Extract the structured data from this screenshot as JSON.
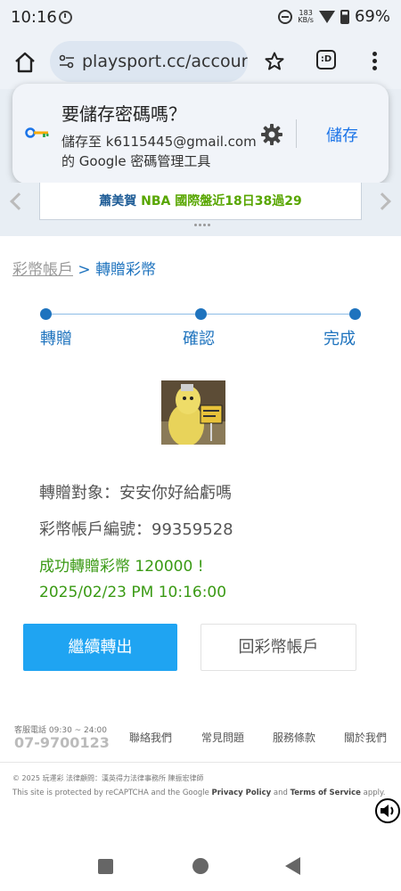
{
  "status_bar": {
    "time": "10:16",
    "net_speed_value": "183",
    "net_speed_unit": "KB/s",
    "battery": "69%"
  },
  "browser": {
    "url": "playsport.cc/accour",
    "tab_label": ":D"
  },
  "password_prompt": {
    "title": "要儲存密碼嗎？",
    "description_line1": "儲存至 k6115445@gmail.com",
    "description_line2": "的 Google 密碼管理工具",
    "save_label": "儲存"
  },
  "banner": {
    "name": "蕭美賀",
    "text": "NBA 國際盤近18日38過29"
  },
  "breadcrumb": {
    "parent": "彩幣帳戶",
    "separator": ">",
    "current": "轉贈彩幣"
  },
  "steps": [
    {
      "label": "轉贈"
    },
    {
      "label": "確認"
    },
    {
      "label": "完成"
    }
  ],
  "transfer": {
    "recipient": "轉贈對象：安安你好給虧嗎",
    "account_number": "彩幣帳戶編號：99359528",
    "success_message": "成功轉贈彩幣 120000 !",
    "timestamp": "2025/02/23 PM 10:16:00"
  },
  "actions": {
    "continue_label": "繼續轉出",
    "back_label": "回彩幣帳戶"
  },
  "footer": {
    "hotline_label": "客服電話 09:30 ~ 24:00",
    "hotline_number": "07-9700123",
    "links": [
      "聯絡我們",
      "常見問題",
      "服務條款",
      "關於我們"
    ],
    "copyright": "© 2025 玩運彩 法律顧問：漢英得力法律事務所 陳振宏律師",
    "recaptcha_prefix": "This site is protected by reCAPTCHA and the Google ",
    "privacy_policy": "Privacy Policy",
    "recaptcha_and": " and ",
    "terms_of_service": "Terms of Service",
    "recaptcha_suffix": " apply."
  },
  "colors": {
    "brand_blue": "#1e73be",
    "primary_button": "#1fa4f2",
    "success_green": "#3a9a14",
    "google_blue": "#1a73e8"
  }
}
